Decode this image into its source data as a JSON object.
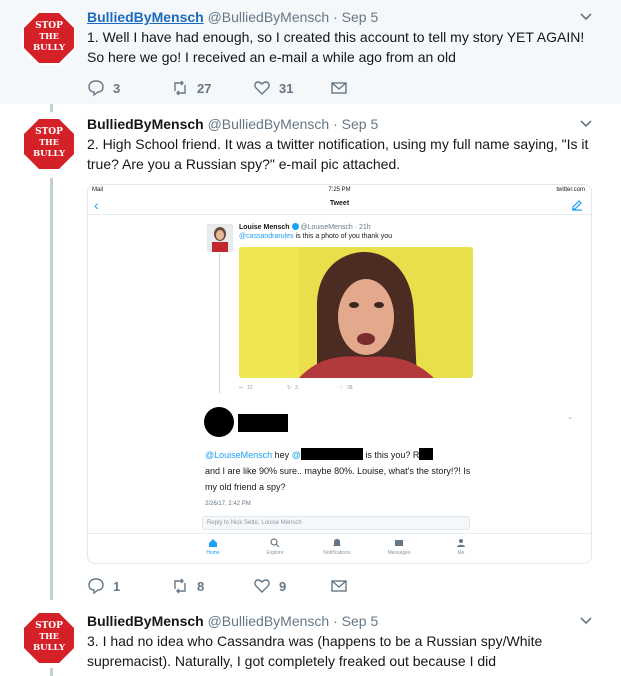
{
  "tweets": [
    {
      "display_name": "BulliedByMensch",
      "handle": "@BulliedByMensch",
      "time": "· Sep 5",
      "text": "1. Well I have had enough, so I created this account to tell my story YET AGAIN! So here we go! I received an e-mail a while ago from an old",
      "replies": "3",
      "retweets": "27",
      "likes": "31"
    },
    {
      "display_name": "BulliedByMensch",
      "handle": "@BulliedByMensch",
      "time": "· Sep 5",
      "text": "2. High School friend. It was a twitter notification, using my full name saying, \"Is it true? Are you a Russian spy?\" e-mail pic attached.",
      "replies": "1",
      "retweets": "8",
      "likes": "9"
    },
    {
      "display_name": "BulliedByMensch",
      "handle": "@BulliedByMensch",
      "time": "· Sep 5",
      "text": "3. I had no idea who Cassandra was (happens to be a Russian spy/White supremacist). Naturally, I got completely freaked out because I did"
    }
  ],
  "avatar": {
    "line1": "STOP",
    "line2": "THE",
    "line3": "BULLY",
    "color": "#d42128"
  },
  "screenshot": {
    "status_left": "Mail",
    "status_time": "7:25 PM",
    "status_right": "twitter.com",
    "nav_title": "Tweet",
    "quoted_name": "Louise Mensch",
    "quoted_handle": "@LouiseMensch · 21h",
    "quoted_mention": "@cassandrarules",
    "quoted_text": " is this a photo of you thank you",
    "quoted_replies": "12",
    "quoted_retweets": "3",
    "quoted_likes": "38",
    "reply_mention": "@LouiseMensch",
    "reply_hey": " hey ",
    "reply_at": "@",
    "reply_is_this_you": " is this you? R",
    "reply_rest": "and I are like 90% sure.. maybe 80%. Louise, what's the story!?! Is my old friend a spy?",
    "reply_time": "2/26/17, 2:42 PM",
    "reply_box": "Reply to Nick Sette, Louise Mensch",
    "tabs": [
      "Home",
      "Explore",
      "Notifications",
      "Messages",
      "Me"
    ]
  },
  "colors": {
    "accent": "#1da1f2",
    "muted": "#657786",
    "link_name": "#1b6ac0"
  }
}
